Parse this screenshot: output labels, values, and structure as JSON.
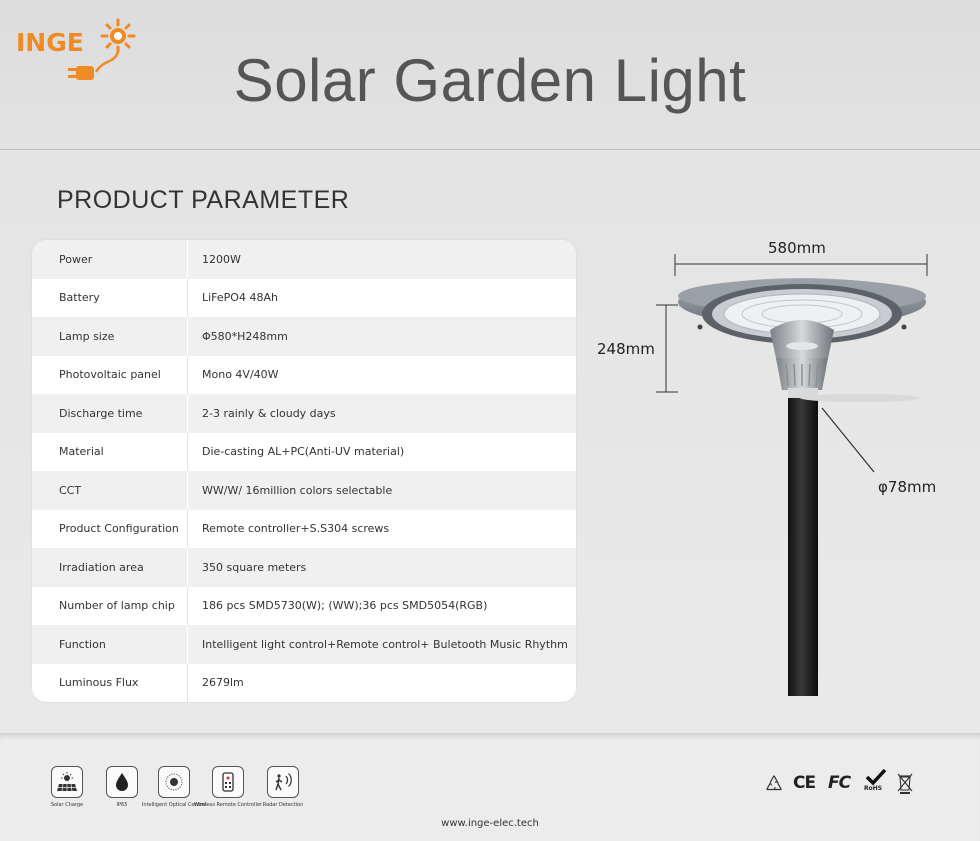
{
  "brand": {
    "name": "INGE",
    "color": "#f08a24"
  },
  "title": "Solar Garden Light",
  "section_title": "PRODUCT PARAMETER",
  "parameters": [
    {
      "name": "Power",
      "value": "1200W"
    },
    {
      "name": "Battery",
      "value": "LiFePO4 48Ah"
    },
    {
      "name": "Lamp size",
      "value": "Φ580*H248mm"
    },
    {
      "name": "Photovoltaic panel",
      "value": "Mono 4V/40W"
    },
    {
      "name": "Discharge time",
      "value": "2-3 rainly & cloudy days"
    },
    {
      "name": "Material",
      "value": "Die-casting AL+PC(Anti-UV material)"
    },
    {
      "name": "CCT",
      "value": "WW/W/ 16million colors selectable"
    },
    {
      "name": "Product Configuration",
      "value": "Remote controller+S.S304 screws"
    },
    {
      "name": "Irradiation area",
      "value": "350 square meters"
    },
    {
      "name": "Number of lamp chip",
      "value": "186 pcs SMD5730(W);  (WW);36 pcs SMD5054(RGB)"
    },
    {
      "name": "Function",
      "value": "Intelligent light control+Remote control+ Buletooth Music Rhythm"
    },
    {
      "name": "Luminous Flux",
      "value": "2679lm"
    }
  ],
  "dimensions": {
    "width": "580mm",
    "height": "248mm",
    "pole": "φ78mm"
  },
  "features": [
    {
      "icon": "solar-charge-icon",
      "label": "Solar Charge"
    },
    {
      "icon": "water-drop-icon",
      "label": "IP65"
    },
    {
      "icon": "optical-sensor-icon",
      "label": "Intelligent Optical Control"
    },
    {
      "icon": "remote-control-icon",
      "label": "Wireless Remote Controller"
    },
    {
      "icon": "radar-detection-icon",
      "label": "Radar Detection"
    }
  ],
  "certifications": [
    "recycle-icon",
    "ce-mark-icon",
    "fcc-mark-icon",
    "rohs-mark-icon",
    "weee-bin-icon"
  ],
  "certification_text": {
    "ce": "CE",
    "fc": "FC",
    "rohs": "RoHS"
  },
  "website": "www.inge-elec.tech"
}
